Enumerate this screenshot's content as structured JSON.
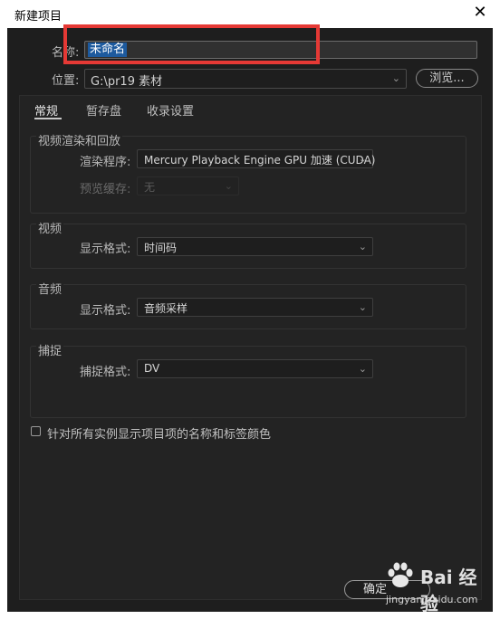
{
  "window": {
    "title": "新建项目",
    "close_glyph": "✕"
  },
  "form": {
    "name_label": "名称:",
    "name_value": "未命名",
    "location_label": "位置:",
    "location_value": "G:\\pr19 素材",
    "browse_label": "浏览..."
  },
  "tabs": [
    {
      "label": "常规",
      "active": true
    },
    {
      "label": "暂存盘",
      "active": false
    },
    {
      "label": "收录设置",
      "active": false
    }
  ],
  "groups": {
    "video_render": {
      "title": "视频渲染和回放",
      "renderer_label": "渲染程序:",
      "renderer_value": "Mercury Playback Engine GPU 加速 (CUDA)",
      "preview_cache_label": "预览缓存:",
      "preview_cache_value": "无"
    },
    "video": {
      "title": "视频",
      "display_format_label": "显示格式:",
      "display_format_value": "时间码"
    },
    "audio": {
      "title": "音频",
      "display_format_label": "显示格式:",
      "display_format_value": "音频采样"
    },
    "capture": {
      "title": "捕捉",
      "capture_format_label": "捕捉格式:",
      "capture_format_value": "DV"
    }
  },
  "checkbox": {
    "label": "针对所有实例显示项目项的名称和标签颜色",
    "checked": false
  },
  "buttons": {
    "ok_label": "确定"
  },
  "watermark": {
    "brand": "Bai 经验",
    "url": "jingyan.baidu.com"
  },
  "colors": {
    "highlight_box": "#e53935",
    "selection": "#1d5a9e",
    "dialog_bg": "#1e1e1e"
  },
  "icons": {
    "dropdown": "chevron-down-icon",
    "close": "close-icon"
  }
}
